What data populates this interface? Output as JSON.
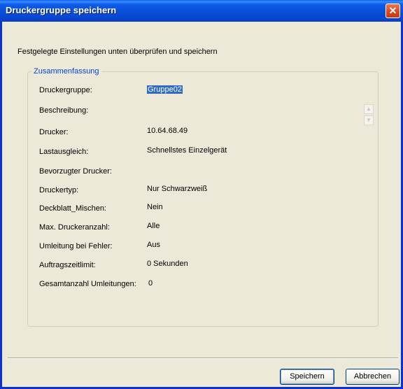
{
  "window": {
    "title": "Druckergruppe speichern",
    "close_glyph": "✕"
  },
  "intro_text": "Festgelegte Einstellungen unten überprüfen und speichern",
  "summary": {
    "legend": "Zusammenfassung",
    "rows": [
      {
        "label": "Druckergruppe:",
        "value": "Gruppe02"
      },
      {
        "label": "Beschreibung:",
        "value": ""
      },
      {
        "label": "Drucker:",
        "value": "10.64.68.49"
      },
      {
        "label": "Lastausgleich:",
        "value": "Schnellstes Einzelgerät"
      },
      {
        "label": "Bevorzugter Drucker:",
        "value": ""
      },
      {
        "label": "Druckertyp:",
        "value": "Nur Schwarzweiß"
      },
      {
        "label": "Deckblatt_Mischen:",
        "value": "Nein"
      },
      {
        "label": "Max. Druckeranzahl:",
        "value": "Alle"
      },
      {
        "label": "Umleitung bei Fehler:",
        "value": "Aus"
      },
      {
        "label": "Auftragszeitlimit:",
        "value": "0 Sekunden"
      },
      {
        "label": "Gesamtanzahl Umleitungen:",
        "value": "0"
      }
    ],
    "scroll_up_glyph": "▲",
    "scroll_down_glyph": "▼"
  },
  "buttons": {
    "save": "Speichern",
    "cancel": "Abbrechen"
  }
}
